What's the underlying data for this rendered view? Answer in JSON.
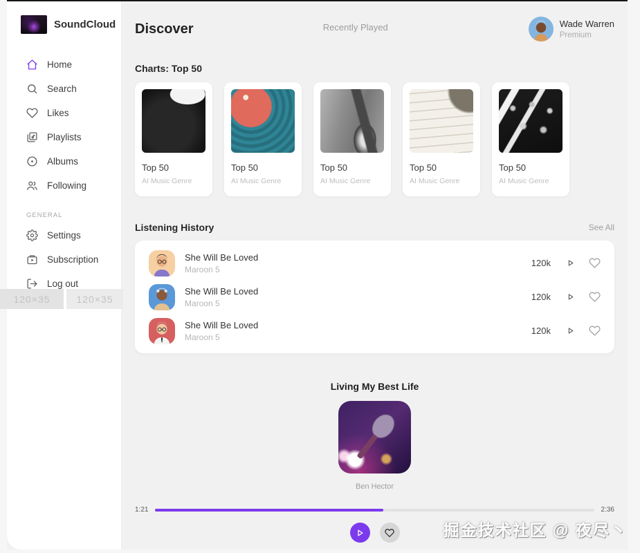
{
  "app": {
    "title": "SoundCloud"
  },
  "sidebar": {
    "logo_label": "SoundCloud",
    "items": [
      {
        "icon": "home-icon",
        "label": "Home",
        "active": true
      },
      {
        "icon": "search-icon",
        "label": "Search",
        "active": false
      },
      {
        "icon": "heart-icon",
        "label": "Likes",
        "active": false
      },
      {
        "icon": "playlists-icon",
        "label": "Playlists",
        "active": false
      },
      {
        "icon": "albums-icon",
        "label": "Albums",
        "active": false
      },
      {
        "icon": "following-icon",
        "label": "Following",
        "active": false
      }
    ],
    "general": {
      "label": "GENERAL",
      "items": [
        {
          "icon": "settings-icon",
          "label": "Settings"
        },
        {
          "icon": "subscription-icon",
          "label": "Subscription"
        },
        {
          "icon": "logout-icon",
          "label": "Log out"
        }
      ]
    },
    "placeholders": [
      {
        "label": "120×35"
      },
      {
        "label": "120×35"
      }
    ]
  },
  "header": {
    "title": "Discover",
    "center_label": "Recently Played",
    "user": {
      "name": "Wade Warren",
      "plan": "Premium",
      "avatar": "wade-warren-avatar"
    }
  },
  "charts": {
    "heading": "Charts: Top 50",
    "cards": [
      {
        "title": "Top 50",
        "subtitle": "AI Music Genre",
        "art": "black-vinyl-record"
      },
      {
        "title": "Top 50",
        "subtitle": "AI Music Genre",
        "art": "teal-vinyl-record"
      },
      {
        "title": "Top 50",
        "subtitle": "AI Music Genre",
        "art": "guitar-by-door"
      },
      {
        "title": "Top 50",
        "subtitle": "AI Music Genre",
        "art": "sheet-music"
      },
      {
        "title": "Top 50",
        "subtitle": "AI Music Genre",
        "art": "audio-mixer"
      }
    ]
  },
  "history": {
    "heading": "Listening History",
    "see_all": "See All",
    "rows": [
      {
        "title": "She Will Be Loved",
        "artist": "Maroon 5",
        "plays": "120k",
        "avatar": "memoji-peach"
      },
      {
        "title": "She Will Be Loved",
        "artist": "Maroon 5",
        "plays": "120k",
        "avatar": "memoji-blue"
      },
      {
        "title": "She Will Be Loved",
        "artist": "Maroon 5",
        "plays": "120k",
        "avatar": "memoji-red"
      }
    ]
  },
  "player": {
    "title": "Living My Best Life",
    "artist": "Ben Hector",
    "elapsed": "1:21",
    "duration": "2:36",
    "progress": "52%",
    "art": "microphone-stage-purple"
  },
  "watermark": {
    "text": "掘金技术社区 @ 夜尽丶"
  },
  "colors": {
    "accent": "#7c3aed",
    "background": "#f1f1f1",
    "panel": "#ffffff"
  }
}
